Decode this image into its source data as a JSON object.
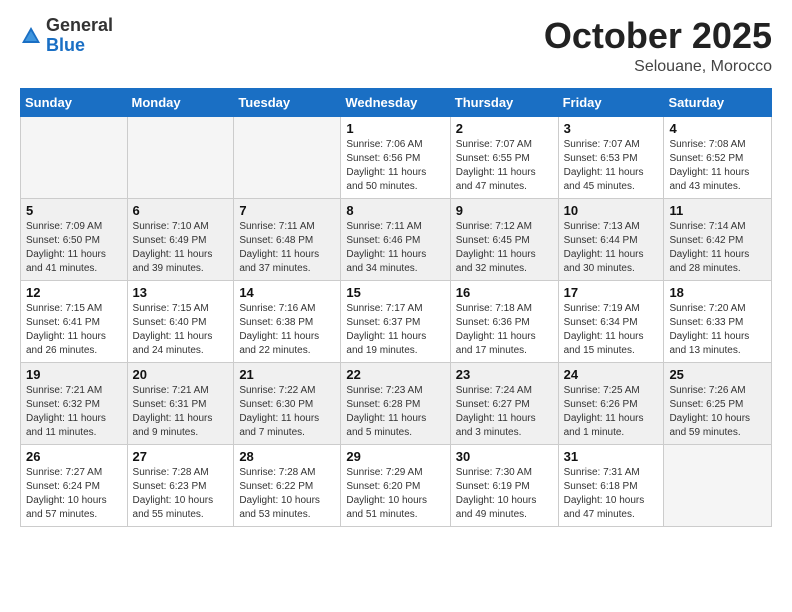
{
  "logo": {
    "general": "General",
    "blue": "Blue"
  },
  "header": {
    "month": "October 2025",
    "location": "Selouane, Morocco"
  },
  "weekdays": [
    "Sunday",
    "Monday",
    "Tuesday",
    "Wednesday",
    "Thursday",
    "Friday",
    "Saturday"
  ],
  "weeks": [
    [
      {
        "day": "",
        "info": ""
      },
      {
        "day": "",
        "info": ""
      },
      {
        "day": "",
        "info": ""
      },
      {
        "day": "1",
        "info": "Sunrise: 7:06 AM\nSunset: 6:56 PM\nDaylight: 11 hours\nand 50 minutes."
      },
      {
        "day": "2",
        "info": "Sunrise: 7:07 AM\nSunset: 6:55 PM\nDaylight: 11 hours\nand 47 minutes."
      },
      {
        "day": "3",
        "info": "Sunrise: 7:07 AM\nSunset: 6:53 PM\nDaylight: 11 hours\nand 45 minutes."
      },
      {
        "day": "4",
        "info": "Sunrise: 7:08 AM\nSunset: 6:52 PM\nDaylight: 11 hours\nand 43 minutes."
      }
    ],
    [
      {
        "day": "5",
        "info": "Sunrise: 7:09 AM\nSunset: 6:50 PM\nDaylight: 11 hours\nand 41 minutes."
      },
      {
        "day": "6",
        "info": "Sunrise: 7:10 AM\nSunset: 6:49 PM\nDaylight: 11 hours\nand 39 minutes."
      },
      {
        "day": "7",
        "info": "Sunrise: 7:11 AM\nSunset: 6:48 PM\nDaylight: 11 hours\nand 37 minutes."
      },
      {
        "day": "8",
        "info": "Sunrise: 7:11 AM\nSunset: 6:46 PM\nDaylight: 11 hours\nand 34 minutes."
      },
      {
        "day": "9",
        "info": "Sunrise: 7:12 AM\nSunset: 6:45 PM\nDaylight: 11 hours\nand 32 minutes."
      },
      {
        "day": "10",
        "info": "Sunrise: 7:13 AM\nSunset: 6:44 PM\nDaylight: 11 hours\nand 30 minutes."
      },
      {
        "day": "11",
        "info": "Sunrise: 7:14 AM\nSunset: 6:42 PM\nDaylight: 11 hours\nand 28 minutes."
      }
    ],
    [
      {
        "day": "12",
        "info": "Sunrise: 7:15 AM\nSunset: 6:41 PM\nDaylight: 11 hours\nand 26 minutes."
      },
      {
        "day": "13",
        "info": "Sunrise: 7:15 AM\nSunset: 6:40 PM\nDaylight: 11 hours\nand 24 minutes."
      },
      {
        "day": "14",
        "info": "Sunrise: 7:16 AM\nSunset: 6:38 PM\nDaylight: 11 hours\nand 22 minutes."
      },
      {
        "day": "15",
        "info": "Sunrise: 7:17 AM\nSunset: 6:37 PM\nDaylight: 11 hours\nand 19 minutes."
      },
      {
        "day": "16",
        "info": "Sunrise: 7:18 AM\nSunset: 6:36 PM\nDaylight: 11 hours\nand 17 minutes."
      },
      {
        "day": "17",
        "info": "Sunrise: 7:19 AM\nSunset: 6:34 PM\nDaylight: 11 hours\nand 15 minutes."
      },
      {
        "day": "18",
        "info": "Sunrise: 7:20 AM\nSunset: 6:33 PM\nDaylight: 11 hours\nand 13 minutes."
      }
    ],
    [
      {
        "day": "19",
        "info": "Sunrise: 7:21 AM\nSunset: 6:32 PM\nDaylight: 11 hours\nand 11 minutes."
      },
      {
        "day": "20",
        "info": "Sunrise: 7:21 AM\nSunset: 6:31 PM\nDaylight: 11 hours\nand 9 minutes."
      },
      {
        "day": "21",
        "info": "Sunrise: 7:22 AM\nSunset: 6:30 PM\nDaylight: 11 hours\nand 7 minutes."
      },
      {
        "day": "22",
        "info": "Sunrise: 7:23 AM\nSunset: 6:28 PM\nDaylight: 11 hours\nand 5 minutes."
      },
      {
        "day": "23",
        "info": "Sunrise: 7:24 AM\nSunset: 6:27 PM\nDaylight: 11 hours\nand 3 minutes."
      },
      {
        "day": "24",
        "info": "Sunrise: 7:25 AM\nSunset: 6:26 PM\nDaylight: 11 hours\nand 1 minute."
      },
      {
        "day": "25",
        "info": "Sunrise: 7:26 AM\nSunset: 6:25 PM\nDaylight: 10 hours\nand 59 minutes."
      }
    ],
    [
      {
        "day": "26",
        "info": "Sunrise: 7:27 AM\nSunset: 6:24 PM\nDaylight: 10 hours\nand 57 minutes."
      },
      {
        "day": "27",
        "info": "Sunrise: 7:28 AM\nSunset: 6:23 PM\nDaylight: 10 hours\nand 55 minutes."
      },
      {
        "day": "28",
        "info": "Sunrise: 7:28 AM\nSunset: 6:22 PM\nDaylight: 10 hours\nand 53 minutes."
      },
      {
        "day": "29",
        "info": "Sunrise: 7:29 AM\nSunset: 6:20 PM\nDaylight: 10 hours\nand 51 minutes."
      },
      {
        "day": "30",
        "info": "Sunrise: 7:30 AM\nSunset: 6:19 PM\nDaylight: 10 hours\nand 49 minutes."
      },
      {
        "day": "31",
        "info": "Sunrise: 7:31 AM\nSunset: 6:18 PM\nDaylight: 10 hours\nand 47 minutes."
      },
      {
        "day": "",
        "info": ""
      }
    ]
  ]
}
